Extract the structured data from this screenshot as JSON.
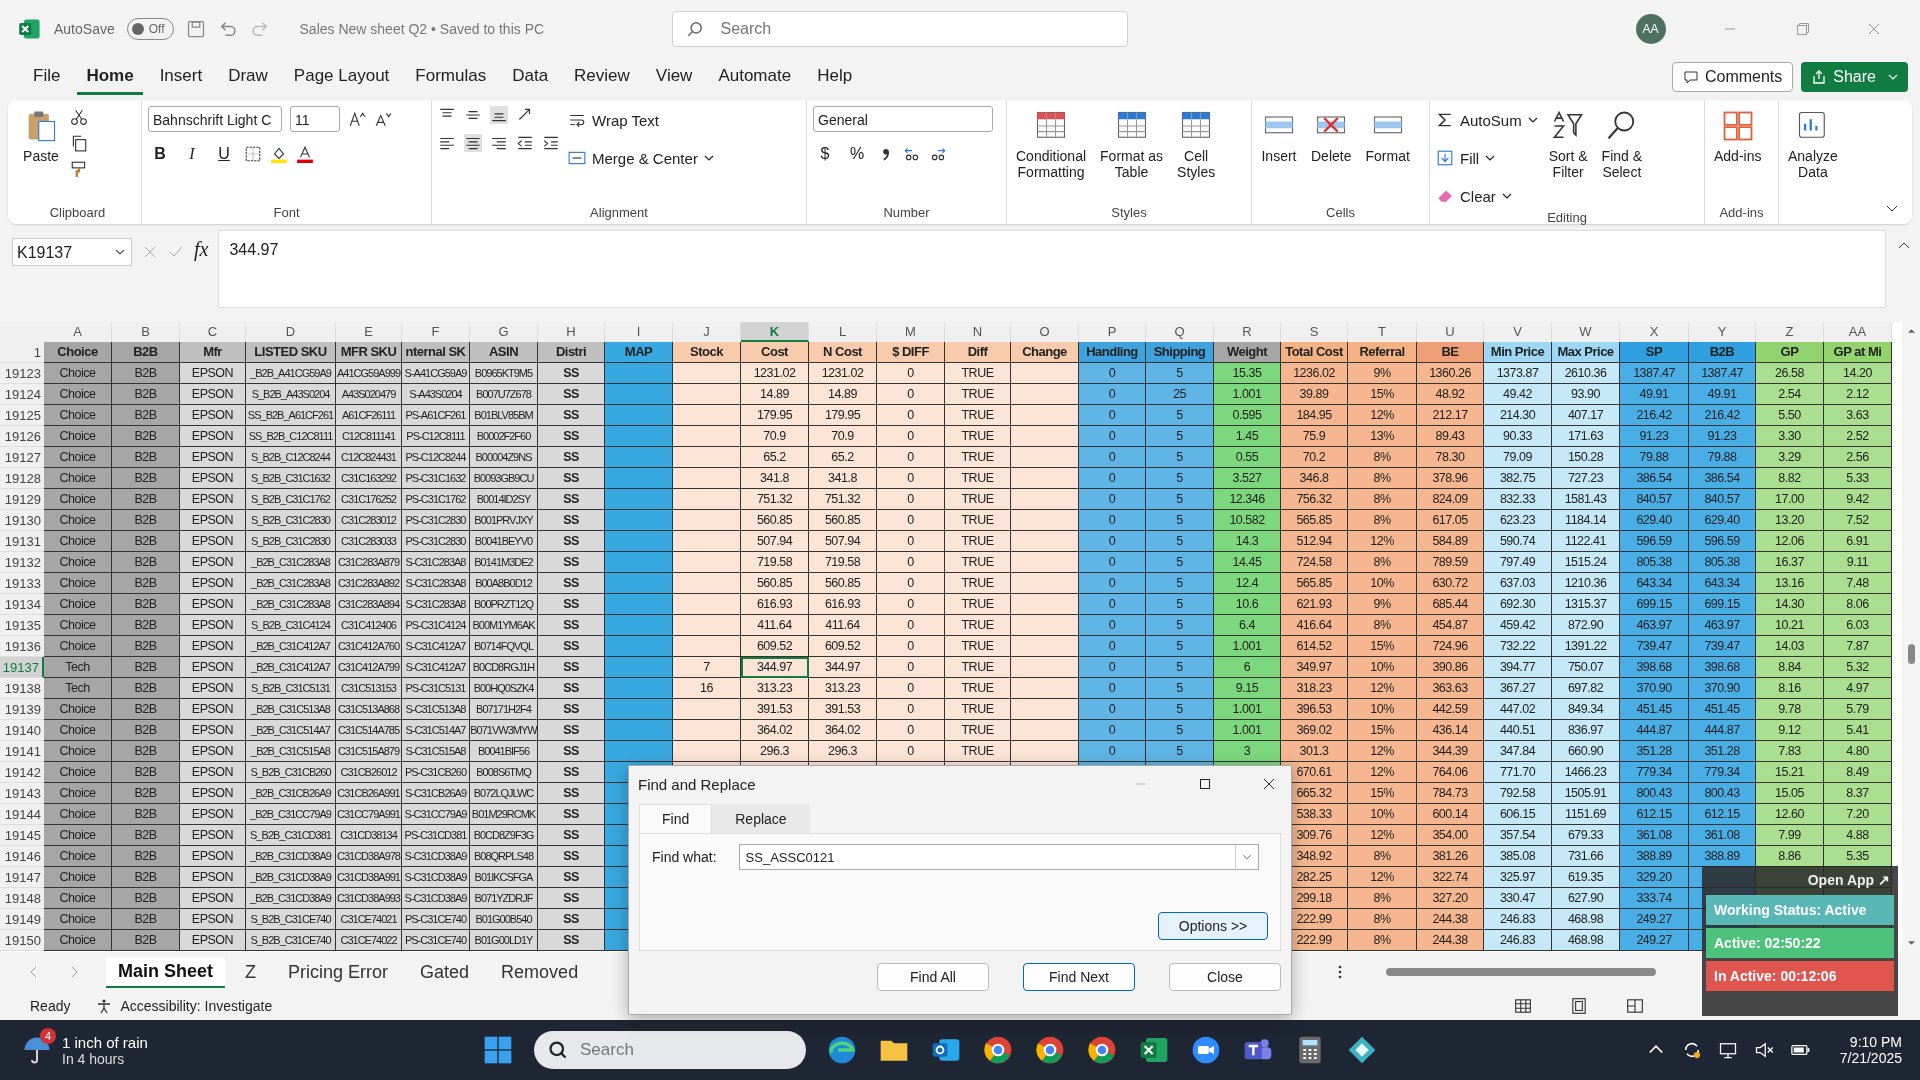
{
  "title_bar": {
    "autosave_label": "AutoSave",
    "autosave": {
      "on": false,
      "label": "Off"
    },
    "document_title": "Sales New sheet Q2 • Saved to this PC",
    "search": {
      "placeholder": "Search"
    },
    "avatar": "AA"
  },
  "menu_tabs": [
    {
      "label": "File",
      "selected": false
    },
    {
      "label": "Home",
      "selected": true
    },
    {
      "label": "Insert",
      "selected": false
    },
    {
      "label": "Draw",
      "selected": false
    },
    {
      "label": "Page Layout",
      "selected": false
    },
    {
      "label": "Formulas",
      "selected": false
    },
    {
      "label": "Data",
      "selected": false
    },
    {
      "label": "Review",
      "selected": false
    },
    {
      "label": "View",
      "selected": false
    },
    {
      "label": "Automate",
      "selected": false
    },
    {
      "label": "Help",
      "selected": false
    }
  ],
  "comments_button": "Comments",
  "share_button": "Share",
  "ribbon": {
    "clipboard": {
      "paste": "Paste",
      "label": "Clipboard"
    },
    "font": {
      "font_name": "Bahnschrift Light C",
      "font_size": "11",
      "bold": "B",
      "italic": "I",
      "underline": "U",
      "label": "Font"
    },
    "alignment": {
      "wrap_text": "Wrap Text",
      "merge_center": "Merge & Center",
      "label": "Alignment"
    },
    "number": {
      "format": "General",
      "currency": "$",
      "percent": "%",
      "label": "Number"
    },
    "styles": {
      "buttons": [
        {
          "lines": [
            "Conditional",
            "Formatting"
          ]
        },
        {
          "lines": [
            "Format as",
            "Table"
          ]
        },
        {
          "lines": [
            "Cell",
            "Styles"
          ]
        }
      ],
      "label": "Styles"
    },
    "cells": {
      "buttons": [
        {
          "lines": [
            "Insert"
          ]
        },
        {
          "lines": [
            "Delete"
          ]
        },
        {
          "lines": [
            "Format"
          ]
        }
      ],
      "label": "Cells"
    },
    "editing": {
      "autosum": "AutoSum",
      "fill": "Fill",
      "clear": "Clear",
      "buttons": [
        {
          "lines": [
            "Sort &",
            "Filter"
          ]
        },
        {
          "lines": [
            "Find &",
            "Select"
          ]
        }
      ],
      "label": "Editing"
    },
    "addins": {
      "buttons": [
        {
          "lines": [
            "Add-ins"
          ]
        }
      ],
      "label": "Add-ins"
    },
    "analyze": {
      "lines": [
        "Analyze",
        "Data"
      ]
    }
  },
  "formula_bar": {
    "name_box": "K19137",
    "fx": "fx",
    "value": "344.97"
  },
  "header_row_num": "1",
  "columns": [
    {
      "letter": "A",
      "header": "Choice",
      "selected": false,
      "color": "#a6a6a6"
    },
    {
      "letter": "B",
      "header": "B2B",
      "selected": false,
      "color": "#a6a6a6"
    },
    {
      "letter": "C",
      "header": "Mfr",
      "selected": false,
      "color": "#d9d9d9"
    },
    {
      "letter": "D",
      "header": "LISTED SKU",
      "selected": false,
      "color": "#d9d9d9"
    },
    {
      "letter": "E",
      "header": "MFR SKU",
      "selected": false,
      "color": "#d9d9d9"
    },
    {
      "letter": "F",
      "header": "nternal SK",
      "selected": false,
      "color": "#d9d9d9"
    },
    {
      "letter": "G",
      "header": "ASIN",
      "selected": false,
      "color": "#d9d9d9"
    },
    {
      "letter": "H",
      "header": "Distri",
      "selected": false,
      "color": "#d9d9d9"
    },
    {
      "letter": "I",
      "header": "MAP",
      "selected": false,
      "color": "#38a8e0"
    },
    {
      "letter": "J",
      "header": "Stock",
      "selected": false,
      "color": "#fce4d6"
    },
    {
      "letter": "K",
      "header": "Cost",
      "selected": true,
      "color": "#fce4d6"
    },
    {
      "letter": "L",
      "header": "N Cost",
      "selected": false,
      "color": "#fce4d6"
    },
    {
      "letter": "M",
      "header": "$ DIFF",
      "selected": false,
      "color": "#fce4d6"
    },
    {
      "letter": "N",
      "header": "Diff",
      "selected": false,
      "color": "#fce4d6"
    },
    {
      "letter": "O",
      "header": "Change",
      "selected": false,
      "color": "#fce4d6"
    },
    {
      "letter": "P",
      "header": "Handling",
      "selected": false,
      "color": "#5fb5e5"
    },
    {
      "letter": "Q",
      "header": "Shipping",
      "selected": false,
      "color": "#5fb5e5"
    },
    {
      "letter": "R",
      "header": "Weight",
      "selected": false,
      "color": "#7dd87d"
    },
    {
      "letter": "S",
      "header": "Total Cost",
      "selected": false,
      "color": "#f6b790"
    },
    {
      "letter": "T",
      "header": "Referral",
      "selected": false,
      "color": "#f6b790"
    },
    {
      "letter": "U",
      "header": "BE",
      "selected": false,
      "color": "#f6b790"
    },
    {
      "letter": "V",
      "header": "Min Price",
      "selected": false,
      "color": "#c6e9f8"
    },
    {
      "letter": "W",
      "header": "Max Price",
      "selected": false,
      "color": "#c6e9f8"
    },
    {
      "letter": "X",
      "header": "SP",
      "selected": false,
      "color": "#4aaee6"
    },
    {
      "letter": "Y",
      "header": "B2B",
      "selected": false,
      "color": "#4aaee6"
    },
    {
      "letter": "Z",
      "header": "GP",
      "selected": false,
      "color": "#a9df8e"
    },
    {
      "letter": "AA",
      "header": "GP at Mi",
      "selected": false,
      "color": "#a9df8e"
    }
  ],
  "rows": [
    {
      "num": "19123",
      "selected": false,
      "cells": [
        "Choice",
        "B2B",
        "EPSON",
        "_B2B_A41CG59A9",
        "A41CG59A999",
        "S-A41CG59A9",
        "B0965KT9M5",
        "SS",
        null,
        null,
        "1231.02",
        "1231.02",
        "0",
        "TRUE",
        null,
        "0",
        "5",
        "15.35",
        "1236.02",
        "9%",
        "1360.26",
        "1373.87",
        "2610.36",
        "1387.47",
        "1387.47",
        "26.58",
        "14.20"
      ]
    },
    {
      "num": "19124",
      "selected": false,
      "cells": [
        "Choice",
        "B2B",
        "EPSON",
        "S_B2B_A43S0204",
        "A43S020479",
        "S-A43S0204",
        "B007U7Z678",
        "SS",
        null,
        null,
        "14.89",
        "14.89",
        "0",
        "TRUE",
        null,
        "0",
        "25",
        "1.001",
        "39.89",
        "15%",
        "48.92",
        "49.42",
        "93.90",
        "49.91",
        "49.91",
        "2.54",
        "2.12"
      ]
    },
    {
      "num": "19125",
      "selected": false,
      "cells": [
        "Choice",
        "B2B",
        "EPSON",
        "SS_B2B_A61CF261",
        "A61CF26111",
        "PS-A61CF261",
        "B01BLV85BM",
        "SS",
        null,
        null,
        "179.95",
        "179.95",
        "0",
        "TRUE",
        null,
        "0",
        "5",
        "0.595",
        "184.95",
        "12%",
        "212.17",
        "214.30",
        "407.17",
        "216.42",
        "216.42",
        "5.50",
        "3.63"
      ]
    },
    {
      "num": "19126",
      "selected": false,
      "cells": [
        "Choice",
        "B2B",
        "EPSON",
        "SS_B2B_C12C8111",
        "C12C811141",
        "PS-C12C8111",
        "B0002F2F60",
        "SS",
        null,
        null,
        "70.9",
        "70.9",
        "0",
        "TRUE",
        null,
        "0",
        "5",
        "1.45",
        "75.9",
        "13%",
        "89.43",
        "90.33",
        "171.63",
        "91.23",
        "91.23",
        "3.30",
        "2.52"
      ]
    },
    {
      "num": "19127",
      "selected": false,
      "cells": [
        "Choice",
        "B2B",
        "EPSON",
        "S_B2B_C12C8244",
        "C12C824431",
        "PS-C12C8244",
        "B00004Z9NS",
        "SS",
        null,
        null,
        "65.2",
        "65.2",
        "0",
        "TRUE",
        null,
        "0",
        "5",
        "0.55",
        "70.2",
        "8%",
        "78.30",
        "79.09",
        "150.28",
        "79.88",
        "79.88",
        "3.29",
        "2.56"
      ]
    },
    {
      "num": "19128",
      "selected": false,
      "cells": [
        "Choice",
        "B2B",
        "EPSON",
        "S_B2B_C31C1632",
        "C31C163292",
        "PS-C31C1632",
        "B0093GB9CU",
        "SS",
        null,
        null,
        "341.8",
        "341.8",
        "0",
        "TRUE",
        null,
        "0",
        "5",
        "3.527",
        "346.8",
        "8%",
        "378.96",
        "382.75",
        "727.23",
        "386.54",
        "386.54",
        "8.82",
        "5.33"
      ]
    },
    {
      "num": "19129",
      "selected": false,
      "cells": [
        "Choice",
        "B2B",
        "EPSON",
        "S_B2B_C31C1762",
        "C31C176252",
        "PS-C31C1762",
        "B0014ID2SY",
        "SS",
        null,
        null,
        "751.32",
        "751.32",
        "0",
        "TRUE",
        null,
        "0",
        "5",
        "12.346",
        "756.32",
        "8%",
        "824.09",
        "832.33",
        "1581.43",
        "840.57",
        "840.57",
        "17.00",
        "9.42"
      ]
    },
    {
      "num": "19130",
      "selected": false,
      "cells": [
        "Choice",
        "B2B",
        "EPSON",
        "S_B2B_C31C2830",
        "C31C283012",
        "PS-C31C2830",
        "B001PRVJXY",
        "SS",
        null,
        null,
        "560.85",
        "560.85",
        "0",
        "TRUE",
        null,
        "0",
        "5",
        "10.582",
        "565.85",
        "8%",
        "617.05",
        "623.23",
        "1184.14",
        "629.40",
        "629.40",
        "13.20",
        "7.52"
      ]
    },
    {
      "num": "19131",
      "selected": false,
      "cells": [
        "Choice",
        "B2B",
        "EPSON",
        "S_B2B_C31C2830",
        "C31C283033",
        "PS-C31C2830",
        "B0041BEYV0",
        "SS",
        null,
        null,
        "507.94",
        "507.94",
        "0",
        "TRUE",
        null,
        "0",
        "5",
        "14.3",
        "512.94",
        "12%",
        "584.89",
        "590.74",
        "1122.41",
        "596.59",
        "596.59",
        "12.06",
        "6.91"
      ]
    },
    {
      "num": "19132",
      "selected": false,
      "cells": [
        "Choice",
        "B2B",
        "EPSON",
        "_B2B_C31C283A8",
        "C31C283A879",
        "S-C31C283A8",
        "B0141M3DE2",
        "SS",
        null,
        null,
        "719.58",
        "719.58",
        "0",
        "TRUE",
        null,
        "0",
        "5",
        "14.45",
        "724.58",
        "8%",
        "789.59",
        "797.49",
        "1515.24",
        "805.38",
        "805.38",
        "16.37",
        "9.11"
      ]
    },
    {
      "num": "19133",
      "selected": false,
      "cells": [
        "Choice",
        "B2B",
        "EPSON",
        "_B2B_C31C283A8",
        "C31C283A892",
        "S-C31C283A8",
        "B00A8B0D12",
        "SS",
        null,
        null,
        "560.85",
        "560.85",
        "0",
        "TRUE",
        null,
        "0",
        "5",
        "12.4",
        "565.85",
        "10%",
        "630.72",
        "637.03",
        "1210.36",
        "643.34",
        "643.34",
        "13.16",
        "7.48"
      ]
    },
    {
      "num": "19134",
      "selected": false,
      "cells": [
        "Choice",
        "B2B",
        "EPSON",
        "_B2B_C31C283A8",
        "C31C283A894",
        "S-C31C283A8",
        "B00PRZT12Q",
        "SS",
        null,
        null,
        "616.93",
        "616.93",
        "0",
        "TRUE",
        null,
        "0",
        "5",
        "10.6",
        "621.93",
        "9%",
        "685.44",
        "692.30",
        "1315.37",
        "699.15",
        "699.15",
        "14.30",
        "8.06"
      ]
    },
    {
      "num": "19135",
      "selected": false,
      "cells": [
        "Choice",
        "B2B",
        "EPSON",
        "S_B2B_C31C4124",
        "C31C412406",
        "PS-C31C4124",
        "B00M1YM6AK",
        "SS",
        null,
        null,
        "411.64",
        "411.64",
        "0",
        "TRUE",
        null,
        "0",
        "5",
        "6.4",
        "416.64",
        "8%",
        "454.87",
        "459.42",
        "872.90",
        "463.97",
        "463.97",
        "10.21",
        "6.03"
      ]
    },
    {
      "num": "19136",
      "selected": false,
      "cells": [
        "Choice",
        "B2B",
        "EPSON",
        "_B2B_C31C412A7",
        "C31C412A760",
        "S-C31C412A7",
        "B0714FQVQL",
        "SS",
        null,
        null,
        "609.52",
        "609.52",
        "0",
        "TRUE",
        null,
        "0",
        "5",
        "1.001",
        "614.52",
        "15%",
        "724.96",
        "732.22",
        "1391.22",
        "739.47",
        "739.47",
        "14.03",
        "7.87"
      ]
    },
    {
      "num": "19137",
      "selected": true,
      "cells": [
        "Tech",
        "B2B",
        "EPSON",
        "_B2B_C31C412A7",
        "C31C412A799",
        "S-C31C412A7",
        "B0CD8RGJ1H",
        "SS",
        null,
        "7",
        "344.97",
        "344.97",
        "0",
        "TRUE",
        null,
        "0",
        "5",
        "6",
        "349.97",
        "10%",
        "390.86",
        "394.77",
        "750.07",
        "398.68",
        "398.68",
        "8.84",
        "5.32"
      ]
    },
    {
      "num": "19138",
      "selected": false,
      "cells": [
        "Tech",
        "B2B",
        "EPSON",
        "S_B2B_C31C5131",
        "C31C513153",
        "PS-C31C5131",
        "B00HQ0SZK4",
        "SS",
        null,
        "16",
        "313.23",
        "313.23",
        "0",
        "TRUE",
        null,
        "0",
        "5",
        "9.15",
        "318.23",
        "12%",
        "363.63",
        "367.27",
        "697.82",
        "370.90",
        "370.90",
        "8.16",
        "4.97"
      ]
    },
    {
      "num": "19139",
      "selected": false,
      "cells": [
        "Choice",
        "B2B",
        "EPSON",
        "_B2B_C31C513A8",
        "C31C513A868",
        "S-C31C513A8",
        "B07171H2F4",
        "SS",
        null,
        null,
        "391.53",
        "391.53",
        "0",
        "TRUE",
        null,
        "0",
        "5",
        "1.001",
        "396.53",
        "10%",
        "442.59",
        "447.02",
        "849.34",
        "451.45",
        "451.45",
        "9.78",
        "5.79"
      ]
    },
    {
      "num": "19140",
      "selected": false,
      "cells": [
        "Choice",
        "B2B",
        "EPSON",
        "_B2B_C31C514A7",
        "C31C514A785",
        "S-C31C514A7",
        "B071VW3MYW",
        "SS",
        null,
        null,
        "364.02",
        "364.02",
        "0",
        "TRUE",
        null,
        "0",
        "5",
        "1.001",
        "369.02",
        "15%",
        "436.14",
        "440.51",
        "836.97",
        "444.87",
        "444.87",
        "9.12",
        "5.41"
      ]
    },
    {
      "num": "19141",
      "selected": false,
      "cells": [
        "Choice",
        "B2B",
        "EPSON",
        "_B2B_C31C515A8",
        "C31C515A879",
        "S-C31C515A8",
        "B0041BIF56",
        "SS",
        null,
        null,
        "296.3",
        "296.3",
        "0",
        "TRUE",
        null,
        "0",
        "5",
        "3",
        "301.3",
        "12%",
        "344.39",
        "347.84",
        "660.90",
        "351.28",
        "351.28",
        "7.83",
        "4.80"
      ]
    },
    {
      "num": "19142",
      "selected": false,
      "cells": [
        "Choice",
        "B2B",
        "EPSON",
        "S_B2B_C31CB260",
        "C31CB26012",
        "PS-C31CB260",
        "B008S6TMQ",
        "SS",
        null,
        null,
        null,
        null,
        null,
        null,
        null,
        null,
        null,
        null,
        "670.61",
        "12%",
        "764.06",
        "771.70",
        "1466.23",
        "779.34",
        "779.34",
        "15.21",
        "8.49"
      ]
    },
    {
      "num": "19143",
      "selected": false,
      "cells": [
        "Choice",
        "B2B",
        "EPSON",
        "_B2B_C31CB26A9",
        "C31CB26A991",
        "S-C31CB26A9",
        "B072LQJLWC",
        "SS",
        null,
        null,
        null,
        null,
        null,
        null,
        null,
        null,
        null,
        null,
        "665.32",
        "15%",
        "784.73",
        "792.58",
        "1505.91",
        "800.43",
        "800.43",
        "15.05",
        "8.37"
      ]
    },
    {
      "num": "19144",
      "selected": false,
      "cells": [
        "Choice",
        "B2B",
        "EPSON",
        "_B2B_C31CC79A9",
        "C31CC79A991",
        "S-C31CC79A9",
        "B01M29RCMK",
        "SS",
        null,
        null,
        null,
        null,
        null,
        null,
        null,
        null,
        null,
        null,
        "538.33",
        "10%",
        "600.14",
        "606.15",
        "1151.69",
        "612.15",
        "612.15",
        "12.60",
        "7.20"
      ]
    },
    {
      "num": "19145",
      "selected": false,
      "cells": [
        "Choice",
        "B2B",
        "EPSON",
        "S_B2B_C31CD381",
        "C31CD38134",
        "PS-C31CD381",
        "B0CD8Z9F3G",
        "SS",
        null,
        null,
        null,
        null,
        null,
        null,
        null,
        null,
        null,
        null,
        "309.76",
        "12%",
        "354.00",
        "357.54",
        "679.33",
        "361.08",
        "361.08",
        "7.99",
        "4.88"
      ]
    },
    {
      "num": "19146",
      "selected": false,
      "cells": [
        "Choice",
        "B2B",
        "EPSON",
        "_B2B_C31CD38A9",
        "C31CD38A978",
        "S-C31CD38A9",
        "B08QRPLS48",
        "SS",
        null,
        null,
        null,
        null,
        null,
        null,
        null,
        null,
        null,
        null,
        "348.92",
        "8%",
        "381.26",
        "385.08",
        "731.66",
        "388.89",
        "388.89",
        "8.86",
        "5.35"
      ]
    },
    {
      "num": "19147",
      "selected": false,
      "cells": [
        "Choice",
        "B2B",
        "EPSON",
        "_B2B_C31CD38A9",
        "C31CD38A991",
        "S-C31CD38A9",
        "B01IKCSFGA",
        "SS",
        null,
        null,
        null,
        null,
        null,
        null,
        null,
        null,
        null,
        null,
        "282.25",
        "12%",
        "322.74",
        "325.97",
        "619.35",
        "329.20",
        null,
        null,
        null
      ]
    },
    {
      "num": "19148",
      "selected": false,
      "cells": [
        "Choice",
        "B2B",
        "EPSON",
        "_B2B_C31CD38A9",
        "C31CD38A993",
        "S-C31CD38A9",
        "B071YZDRJF",
        "SS",
        null,
        null,
        null,
        null,
        null,
        null,
        null,
        null,
        null,
        null,
        "299.18",
        "8%",
        "327.20",
        "330.47",
        "627.90",
        "333.74",
        null,
        null,
        null
      ]
    },
    {
      "num": "19149",
      "selected": false,
      "cells": [
        "Choice",
        "B2B",
        "EPSON",
        "S_B2B_C31CE740",
        "C31CE74021",
        "PS-C31CE740",
        "B01G00B540",
        "SS",
        null,
        null,
        null,
        null,
        null,
        null,
        null,
        null,
        null,
        null,
        "222.99",
        "8%",
        "244.38",
        "246.83",
        "468.98",
        "249.27",
        null,
        null,
        null
      ]
    },
    {
      "num": "19150",
      "selected": false,
      "cells": [
        "Choice",
        "B2B",
        "EPSON",
        "S_B2B_C31CE740",
        "C31CE74022",
        "PS-C31CE740",
        "B01G00LD1Y",
        "SS",
        null,
        null,
        null,
        null,
        null,
        null,
        null,
        null,
        null,
        null,
        "222.99",
        "8%",
        "244.38",
        "246.83",
        "468.98",
        "249.27",
        null,
        null,
        null
      ]
    }
  ],
  "sheet_tabs": [
    {
      "label": "Main Sheet",
      "selected": true
    },
    {
      "label": "Z",
      "selected": false
    },
    {
      "label": "Pricing Error",
      "selected": false
    },
    {
      "label": "Gated",
      "selected": false
    },
    {
      "label": "Removed",
      "selected": false
    }
  ],
  "status_bar": {
    "ready": "Ready",
    "accessibility": "Accessibility: Investigate"
  },
  "find_dialog": {
    "title": "Find and Replace",
    "tabs": [
      {
        "label": "Find",
        "selected": true
      },
      {
        "label": "Replace",
        "selected": false
      }
    ],
    "find_label": "Find what:",
    "find_value": "SS_ASSC0121",
    "options_button": "Options >>",
    "buttons": [
      "Find All",
      "Find Next",
      "Close"
    ]
  },
  "status_widget": {
    "open_app": "Open App ↗",
    "working": "Working Status: Active",
    "active": "Active: 02:50:22",
    "inactive": "In Active: 00:12:06"
  },
  "taskbar": {
    "weather_badge": "4",
    "weather_title": "1 inch of rain",
    "weather_sub": "In 4 hours",
    "search": {
      "placeholder": "Search"
    },
    "time": "9:10 PM",
    "date": "7/21/2025"
  }
}
